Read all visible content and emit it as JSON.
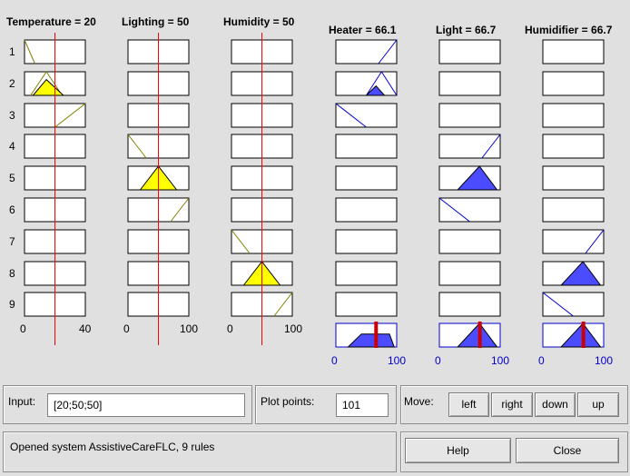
{
  "inputs": [
    {
      "header": "Temperature = 20",
      "min": "0",
      "max": "40"
    },
    {
      "header": "Lighting = 50",
      "min": "0",
      "max": "100"
    },
    {
      "header": "Humidity = 50",
      "min": "0",
      "max": "100"
    }
  ],
  "outputs": [
    {
      "header": "Heater = 66.1",
      "min": "0",
      "max": "100"
    },
    {
      "header": "Light = 66.7",
      "min": "0",
      "max": "100"
    },
    {
      "header": "Humidifier = 66.7",
      "min": "0",
      "max": "100"
    }
  ],
  "rule_numbers": [
    "1",
    "2",
    "3",
    "4",
    "5",
    "6",
    "7",
    "8",
    "9"
  ],
  "colors": {
    "input_fill": "#ffff00",
    "output_fill": "#4b4bff",
    "output_border": "#0000cc",
    "indicator": "#cc0000",
    "result_line": "#ff0000",
    "mf_line": "#808000"
  },
  "controls": {
    "input_label": "Input:",
    "input_value": "[20;50;50]",
    "plot_points_label": "Plot points:",
    "plot_points_value": "101",
    "move_label": "Move:",
    "left": "left",
    "right": "right",
    "down": "down",
    "up": "up",
    "help": "Help",
    "close": "Close",
    "status": "Opened system AssistiveCareFLC, 9 rules"
  }
}
